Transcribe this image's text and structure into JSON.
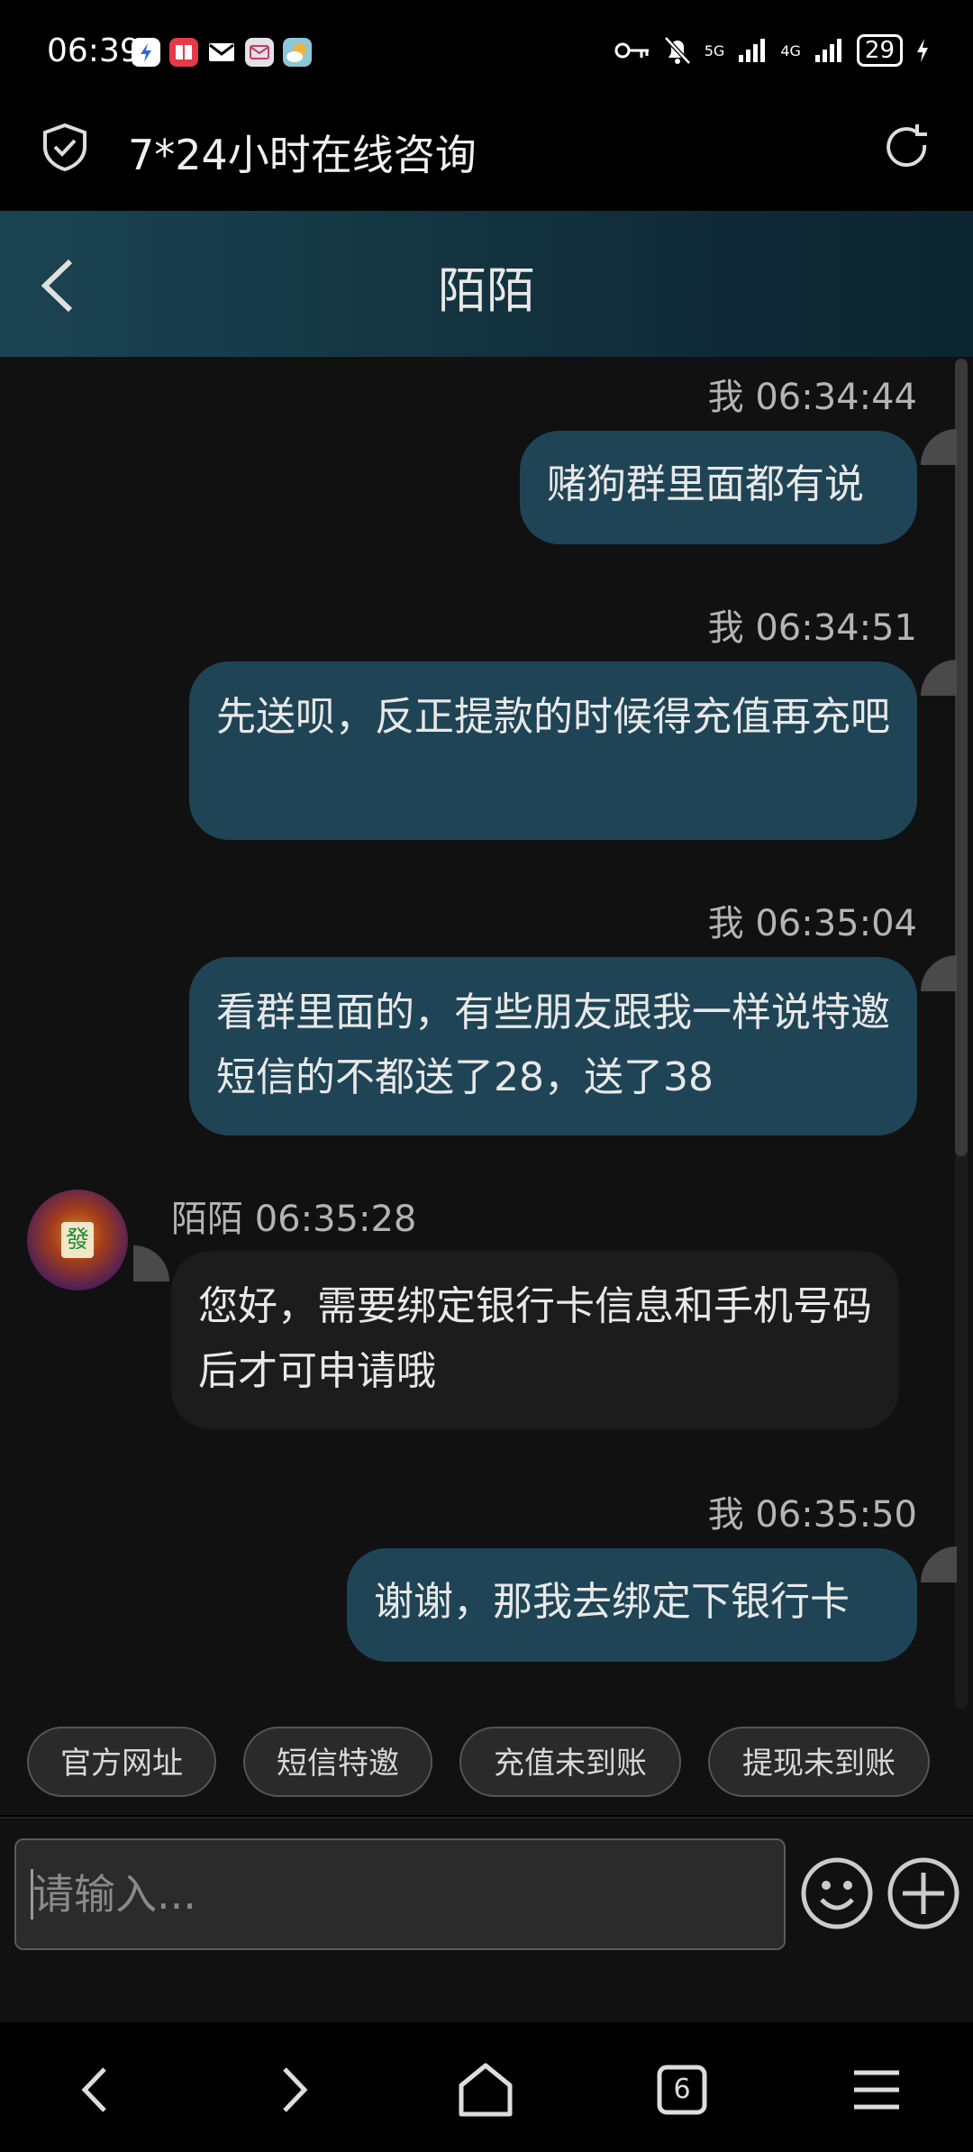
{
  "status_bar": {
    "time": "06:39",
    "battery": "29",
    "network_1": "5G",
    "network_2": "4G"
  },
  "browser": {
    "title": "7*24小时在线咨询"
  },
  "chat_header": {
    "title": "陌陌"
  },
  "messages": [
    {
      "meta": "我 06:34:44",
      "text": "赌狗群里面都有说"
    },
    {
      "meta": "我 06:34:51",
      "text": "先送呗，反正提款的时候得充值再充吧"
    },
    {
      "meta": "我 06:35:04",
      "text": "看群里面的，有些朋友跟我一样说特邀短信的不都送了28，送了38"
    },
    {
      "meta": "陌陌 06:35:28",
      "text": "您好，需要绑定银行卡信息和手机号码后才可申请哦"
    },
    {
      "meta": "我 06:35:50",
      "text": "谢谢，那我去绑定下银行卡"
    }
  ],
  "quick_replies": [
    "官方网址",
    "短信特邀",
    "充值未到账",
    "提现未到账"
  ],
  "input": {
    "placeholder": "请输入..."
  },
  "nav": {
    "tab_count": "6"
  },
  "colors": {
    "header_bg": "#1b4452",
    "bubble_self": "#1f4455",
    "bubble_other": "#1c1c1c",
    "chat_bg": "#111111"
  }
}
